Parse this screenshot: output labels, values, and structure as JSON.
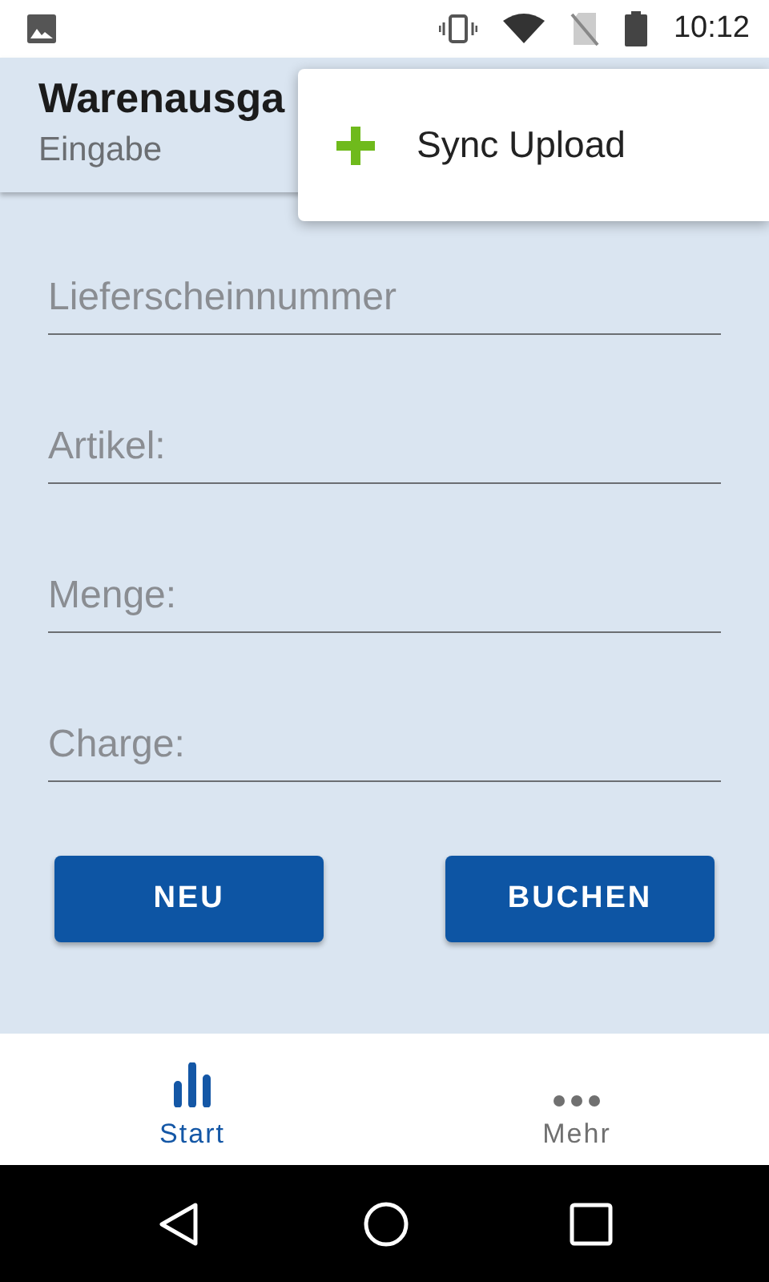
{
  "status_bar": {
    "time": "10:12"
  },
  "header": {
    "title": "Warenausga",
    "subtitle": "Eingabe"
  },
  "menu": {
    "items": [
      {
        "label": "Sync Upload"
      }
    ]
  },
  "fields": [
    {
      "placeholder": "Lieferscheinnummer"
    },
    {
      "placeholder": "Artikel:"
    },
    {
      "placeholder": "Menge:"
    },
    {
      "placeholder": "Charge:"
    }
  ],
  "buttons": [
    "NEU",
    "BUCHEN"
  ],
  "bottom_nav": [
    {
      "label": "Start",
      "kind": "chart",
      "selected": true
    },
    {
      "label": "Mehr",
      "kind": "more",
      "selected": false
    }
  ]
}
